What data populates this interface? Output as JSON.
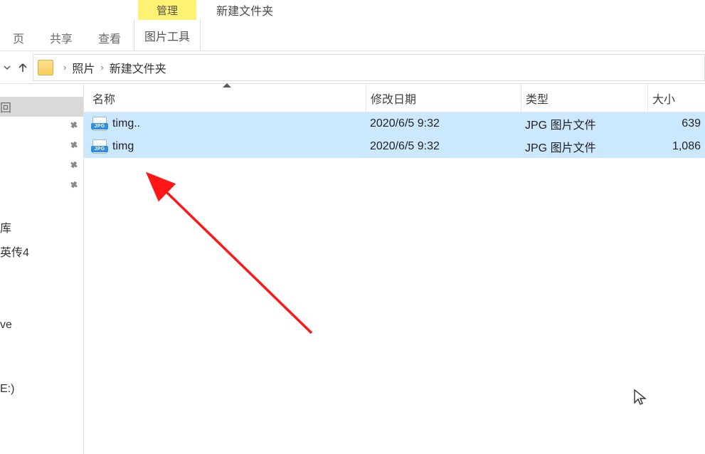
{
  "ribbon": {
    "tab_left_truncated": "页",
    "tab_share": "共享",
    "tab_view": "查看",
    "manage_top": "管理",
    "manage_bottom": "图片工具",
    "right_label": "新建文件夹"
  },
  "address": {
    "breadcrumb1": "照片",
    "breadcrumb2": "新建文件夹"
  },
  "columns": {
    "name": "名称",
    "date": "修改日期",
    "type": "类型",
    "size": "大小"
  },
  "files": [
    {
      "name": "timg..",
      "date": "2020/6/5 9:32",
      "type": "JPG 图片文件",
      "size": "639"
    },
    {
      "name": "timg",
      "date": "2020/6/5 9:32",
      "type": "JPG 图片文件",
      "size": "1,086"
    }
  ],
  "sidebar": {
    "active_suffix": "回",
    "item1": "库",
    "item2": "英传4",
    "item3": "ve",
    "item4": "E:)"
  },
  "jpg_badge": "JPG"
}
